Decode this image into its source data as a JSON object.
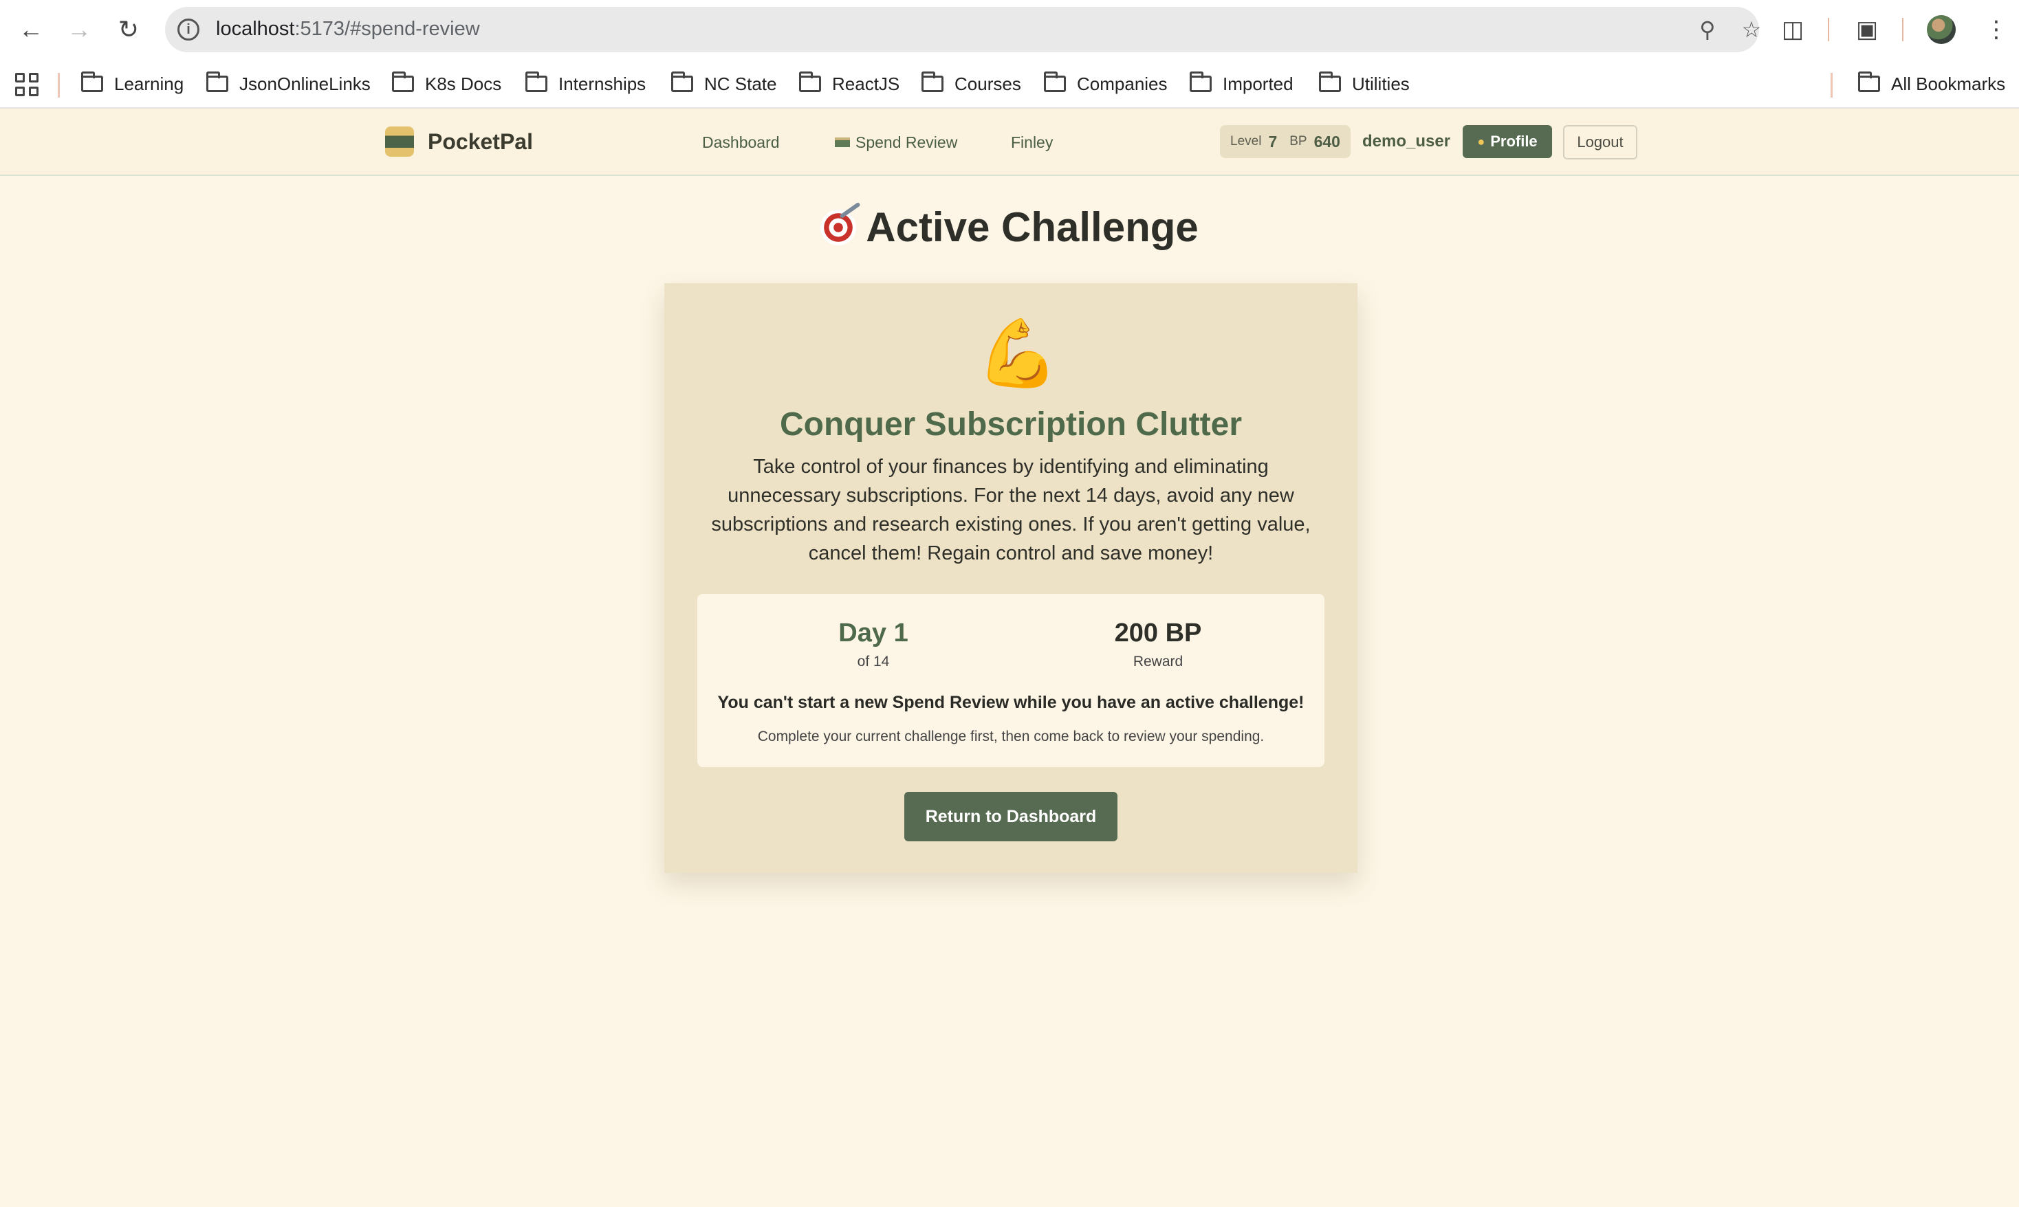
{
  "browser": {
    "url_host": "localhost",
    "url_path": ":5173/#spend-review",
    "bookmarks": [
      "Learning",
      "JsonOnlineLinks",
      "K8s Docs",
      "Internships",
      "NC State",
      "ReactJS",
      "Courses",
      "Companies",
      "Imported",
      "Utilities"
    ],
    "all_bookmarks_label": "All Bookmarks"
  },
  "header": {
    "brand": "PocketPal",
    "nav": {
      "dashboard": "Dashboard",
      "spend_review": "Spend Review",
      "finley": "Finley"
    },
    "level_label": "Level",
    "level_value": "7",
    "bp_label": "BP",
    "bp_value": "640",
    "username": "demo_user",
    "profile_label": "Profile",
    "logout_label": "Logout"
  },
  "main": {
    "page_title": "Active Challenge",
    "challenge": {
      "title": "Conquer Subscription Clutter",
      "description": "Take control of your finances by identifying and eliminating unnecessary subscriptions. For the next 14 days, avoid any new subscriptions and research existing ones. If you aren't getting value, cancel them! Regain control and save money!",
      "day_value": "Day 1",
      "day_sub": "of 14",
      "reward_value": "200 BP",
      "reward_sub": "Reward",
      "warning": "You can't start a new Spend Review while you have an active challenge!",
      "warning_sub": "Complete your current challenge first, then come back to review your spending.",
      "return_button": "Return to Dashboard"
    }
  },
  "colors": {
    "page_bg": "#fdf6e6",
    "card_bg": "#ede2c6",
    "accent_green": "#566b52",
    "title_green": "#4f6a4b"
  }
}
